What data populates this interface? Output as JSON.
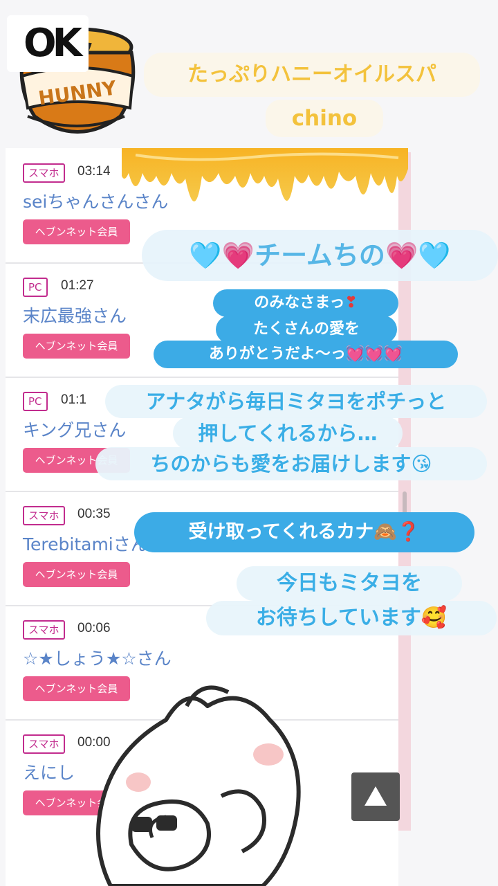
{
  "header": {
    "logo_text": "HUNNY",
    "ok_text": "OK",
    "shop_title": "たっぷりハニーオイルスパ",
    "shop_name": "chino"
  },
  "visitors": [
    {
      "device": "スマホ",
      "time": "03:14",
      "name": "seiちゃんさんさん",
      "member": "ヘブンネット会員"
    },
    {
      "device": "PC",
      "time": "01:27",
      "name": "末広最強さん",
      "member": "ヘブンネット会員"
    },
    {
      "device": "PC",
      "time": "01:1",
      "name": "キング兄さん",
      "member": "ヘブンネット会員"
    },
    {
      "device": "スマホ",
      "time": "00:35",
      "name": "Terebitamiさん",
      "member": "ヘブンネット会員"
    },
    {
      "device": "スマホ",
      "time": "00:06",
      "name": "☆★しょう★☆さん",
      "member": "ヘブンネット会員"
    },
    {
      "device": "スマホ",
      "time": "00:00",
      "name": "えにし",
      "member": "ヘブンネット会員"
    }
  ],
  "messages": {
    "team": "チームちの",
    "thanks_1": "のみなさまっ",
    "thanks_2": "たくさんの愛を",
    "thanks_3": "ありがとうだよ〜っ",
    "love_1": "アナタがら毎日ミタヨをポチっと",
    "love_2": "押してくれるから…",
    "love_3": "ちのからも愛をお届けします",
    "receive": "受け取ってくれるカナ",
    "wait_1": "今日もミタヨを",
    "wait_2": "お待ちしています"
  },
  "emoji": {
    "heart_blue": "🩵",
    "heart_pink": "💗",
    "exclamation": "❣",
    "heart_pulse": "💓",
    "kiss": "😘",
    "monkey": "🙈",
    "question": "❓",
    "smile_hearts": "🥰"
  },
  "colors": {
    "accent_pink": "#ec5b8c",
    "badge_border": "#c22c8e",
    "name_blue": "#5a84c8",
    "bubble_blue": "#3cabe6",
    "honey_yellow": "#f3c23c"
  },
  "icons": {
    "scroll_top": "triangle-up-icon"
  }
}
